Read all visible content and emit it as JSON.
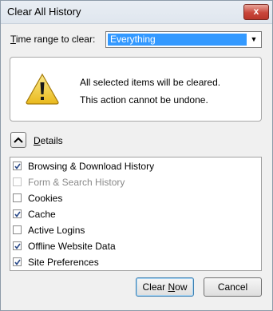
{
  "window": {
    "title": "Clear All History",
    "close_glyph": "x"
  },
  "time_range": {
    "label_prefix": "T",
    "label_rest": "ime range to clear:",
    "selected": "Everything",
    "arrow_glyph": "▼"
  },
  "warning": {
    "icon": "warning-triangle-icon",
    "line1": "All selected items will be cleared.",
    "line2": "This action cannot be undone."
  },
  "details": {
    "label_prefix": "D",
    "label_rest": "etails",
    "expanded": true
  },
  "items": [
    {
      "label": "Browsing & Download History",
      "checked": true,
      "enabled": true
    },
    {
      "label": "Form & Search History",
      "checked": false,
      "enabled": false
    },
    {
      "label": "Cookies",
      "checked": false,
      "enabled": true
    },
    {
      "label": "Cache",
      "checked": true,
      "enabled": true
    },
    {
      "label": "Active Logins",
      "checked": false,
      "enabled": true
    },
    {
      "label": "Offline Website Data",
      "checked": true,
      "enabled": true
    },
    {
      "label": "Site Preferences",
      "checked": true,
      "enabled": true
    }
  ],
  "buttons": {
    "clear_prefix": "Clear ",
    "clear_underlined": "N",
    "clear_rest": "ow",
    "cancel": "Cancel"
  },
  "colors": {
    "selection": "#3399ff",
    "warning_yellow": "#f6d443"
  }
}
